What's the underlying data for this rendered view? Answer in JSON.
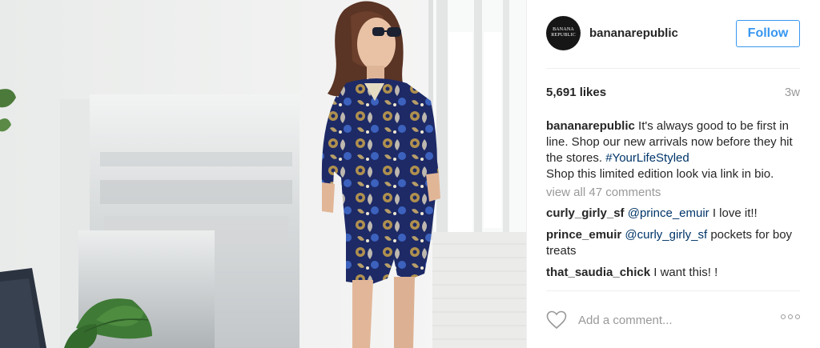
{
  "post": {
    "account": {
      "username": "bananarepublic",
      "avatar_text_line1": "BANANA",
      "avatar_text_line2": "REPUBLIC",
      "follow_label": "Follow"
    },
    "likes_text": "5,691 likes",
    "time_ago": "3w",
    "caption": {
      "user": "bananarepublic",
      "text": "It's always good to be first in line. Shop our new arrivals now before they hit the stores.",
      "hashtag": "#YourLifeStyled",
      "text2": "Shop this limited edition look via link in bio."
    },
    "view_all_comments": "view all 47 comments",
    "comments": [
      {
        "user": "curly_girly_sf",
        "mention": "@prince_emuir",
        "text": "I love it!!"
      },
      {
        "user": "prince_emuir",
        "mention": "@curly_girly_sf",
        "text": "pockets for boy treats"
      },
      {
        "user": "that_saudia_chick",
        "mention": "",
        "text": "I want this! !"
      }
    ],
    "add_comment_placeholder": "Add a comment...",
    "icons": {
      "like": "heart-icon",
      "options": "more-options-icon"
    }
  },
  "colors": {
    "follow_blue": "#3897f0",
    "link_blue": "#003569",
    "muted_gray": "#999999",
    "text_dark": "#262626",
    "dress_navy": "#1d2a66",
    "dress_gold": "#c9a24a"
  }
}
